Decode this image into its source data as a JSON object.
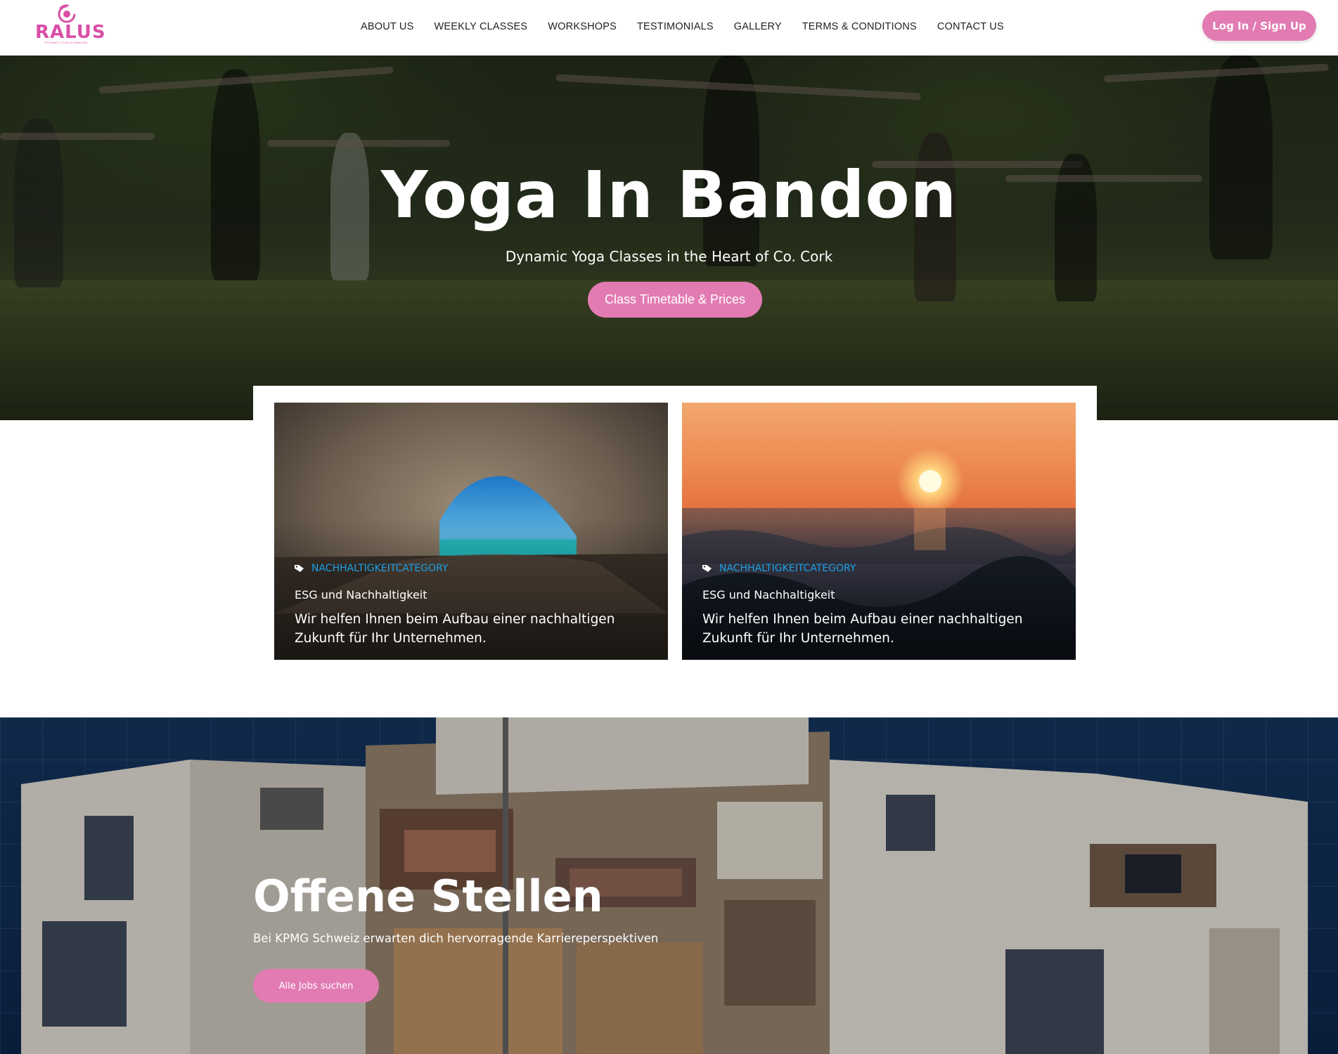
{
  "header": {
    "logo_text": "RALUS",
    "logo_tagline": "DYNAMIC YOGA IN BANDON",
    "nav": [
      {
        "label": "ABOUT US"
      },
      {
        "label": "WEEKLY CLASSES"
      },
      {
        "label": "WORKSHOPS"
      },
      {
        "label": "TESTIMONIALS"
      },
      {
        "label": "GALLERY"
      },
      {
        "label": "TERMS & CONDITIONS"
      },
      {
        "label": "CONTACT US"
      }
    ],
    "login_label": "Log In / Sign Up"
  },
  "hero": {
    "title": "Yoga In Bandon",
    "subtitle": "Dynamic Yoga Classes in the Heart of Co. Cork",
    "button_label": "Class Timetable & Prices"
  },
  "cards": [
    {
      "category": "NACHHALTIGKEITCATEGORY",
      "title": "ESG und Nachhaltigkeit",
      "text": "Wir helfen Ihnen beim Aufbau einer nachhaltigen Zukunft für Ihr Unternehmen.",
      "image": "sea-cave-image"
    },
    {
      "category": "NACHHALTIGKEITCATEGORY",
      "title": "ESG und Nachhaltigkeit",
      "text": "Wir helfen Ihnen beim Aufbau einer nachhaltigen Zukunft für Ihr Unternehmen.",
      "image": "sunset-ocean-image"
    }
  ],
  "jobs": {
    "title": "Offene Stellen",
    "subtitle": "Bei KPMG Schweiz erwarten dich hervorragende Karriereperspektiven",
    "button_label": "Alle Jobs suchen"
  },
  "colors": {
    "accent": "#e27bb2",
    "logo": "#d94fa6",
    "category_link": "#1aa0e6"
  }
}
